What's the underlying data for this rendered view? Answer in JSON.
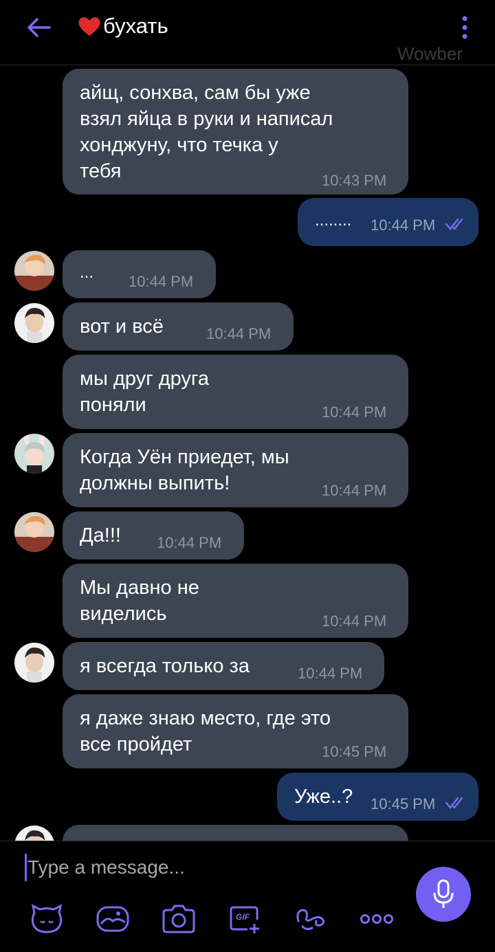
{
  "header": {
    "title": "бухать",
    "watermark": "Wowber",
    "icons": {
      "back": "back-arrow-icon",
      "heart": "heart-icon",
      "menu": "more-vertical-icon"
    }
  },
  "messages": [
    {
      "text": "айщ, сонхва, сам бы уже\nвзял яйца в руки и написал\nхонджуну, что течка у\nтебя",
      "time": "10:43 PM"
    },
    {
      "text": "........",
      "time": "10:44 PM",
      "read": true
    },
    {
      "text": "...",
      "time": "10:44 PM"
    },
    {
      "text": "вот и всё",
      "time": "10:44 PM"
    },
    {
      "text": "мы друг друга\nпоняли",
      "time": "10:44 PM"
    },
    {
      "text": "Когда Уён приедет, мы\nдолжны выпить!",
      "time": "10:44 PM"
    },
    {
      "text": "Да!!!",
      "time": "10:44 PM"
    },
    {
      "text": "Мы давно не\nвиделись",
      "time": "10:44 PM"
    },
    {
      "text": "я всегда только за",
      "time": "10:44 PM"
    },
    {
      "text": "я даже знаю место, где это\nвсе пройдет",
      "time": "10:45 PM"
    },
    {
      "text": "Уже..?",
      "time": "10:45 PM",
      "read": true
    }
  ],
  "input": {
    "placeholder": "Type a message..."
  },
  "toolbar": {
    "icons": [
      "sticker-icon",
      "gallery-icon",
      "camera-icon",
      "gif-icon",
      "doodle-icon",
      "more-horizontal-icon"
    ],
    "gif_label": "GIF",
    "mic_icon": "microphone-icon"
  },
  "colors": {
    "accent": "#7360f2",
    "incoming_bubble": "#3d4452",
    "outgoing_bubble": "#1c3664",
    "background": "#000000"
  }
}
